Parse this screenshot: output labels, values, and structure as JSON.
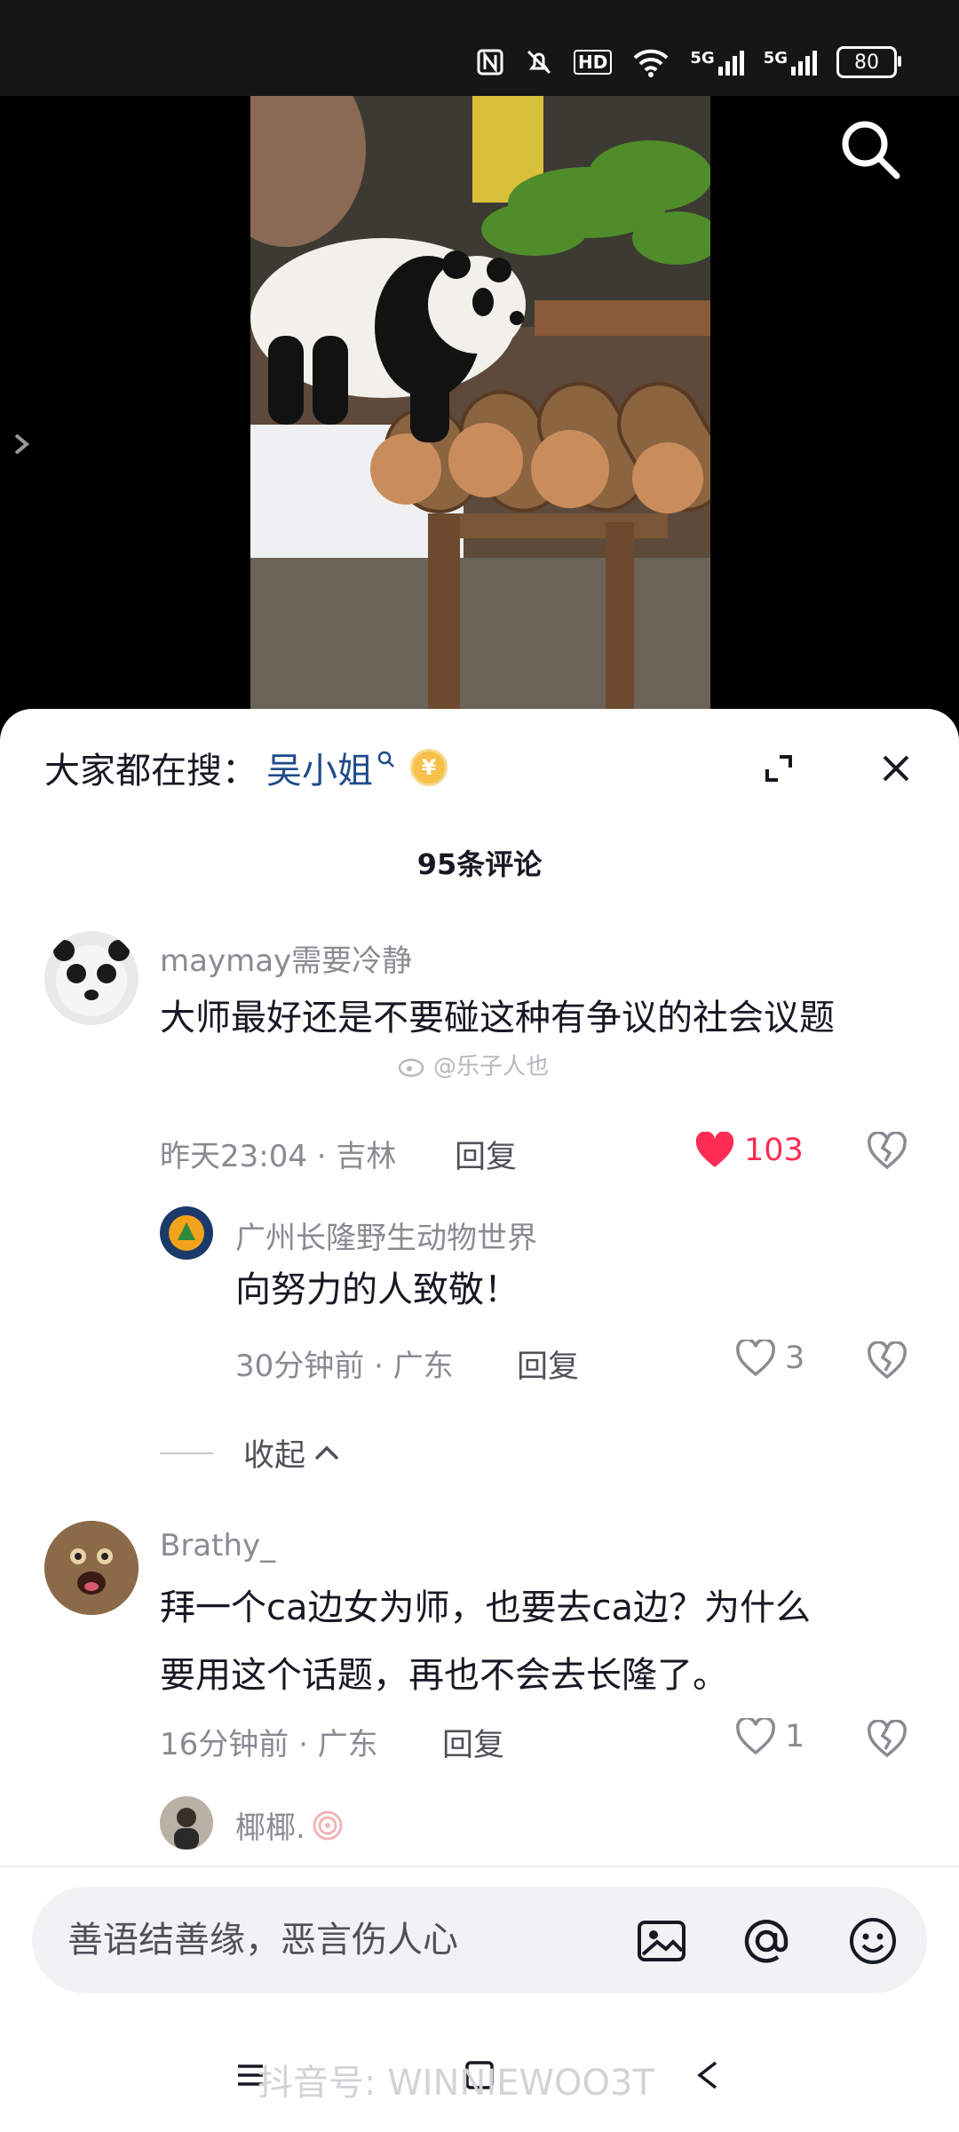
{
  "status_bar": {
    "network_badge": "5G",
    "network_badge_2": "5G",
    "hd_label": "HD",
    "battery": "80"
  },
  "sheet": {
    "trending_prefix": "大家都在搜：",
    "trending_term": "吴小姐",
    "coin_symbol": "¥",
    "comment_count": "95条评论"
  },
  "comments": [
    {
      "username": "maymay需要冷静",
      "text": "大师最好还是不要碰这种有争议的社会议题",
      "meta": "昨天23:04 · 吉林",
      "reply_label": "回复",
      "likes": "103",
      "liked": true,
      "replies": [
        {
          "username": "广州长隆野生动物世界",
          "text": "向努力的人致敬！",
          "meta": "30分钟前 · 广东",
          "reply_label": "回复",
          "likes": "3"
        }
      ],
      "collapse_label": "收起"
    },
    {
      "username": "Brathy_",
      "text_line1": "拜一个ca边女为师，也要去ca边？为什么",
      "text_line2": "要用这个话题，再也不会去长隆了。",
      "meta": "16分钟前 · 广东",
      "reply_label": "回复",
      "likes": "1"
    },
    {
      "username": "椰椰."
    }
  ],
  "watermark": "@乐子人也",
  "input": {
    "placeholder": "善语结善缘，恶言伤人心"
  },
  "bottom_watermark": "抖音号: WINNIEWOO3T"
}
